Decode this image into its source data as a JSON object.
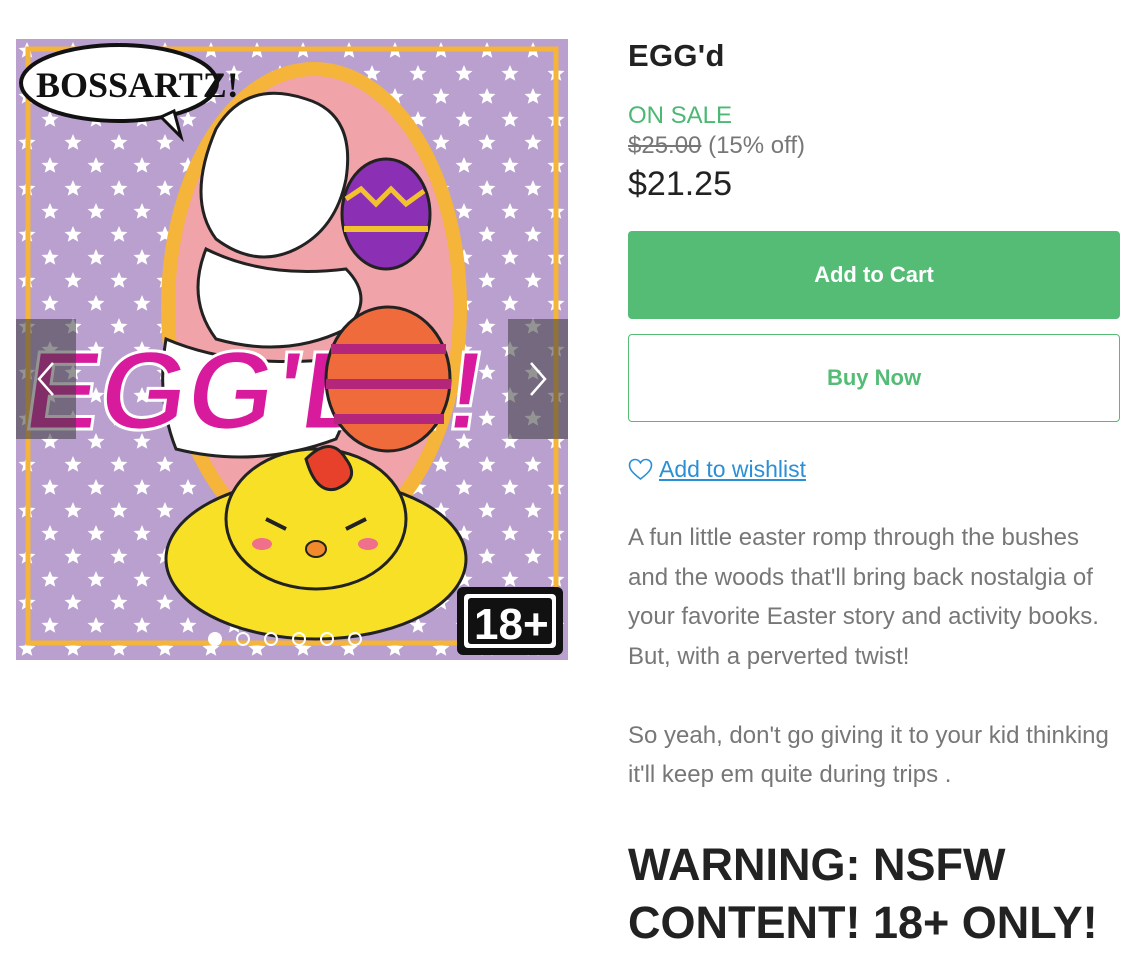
{
  "product": {
    "title": "EGG'd",
    "sale_label": "ON SALE",
    "original_price": "$25.00",
    "discount": "(15% off)",
    "price": "$21.25"
  },
  "actions": {
    "add_to_cart": "Add to Cart",
    "buy_now": "Buy Now",
    "wishlist": "Add to wishlist"
  },
  "description": {
    "paragraph_1": "A fun little easter romp through the bushes and the woods that'll bring back nostalgia of your favorite Easter story and activity books. But, with a perverted twist!",
    "paragraph_2": "So yeah, don't go giving it to your kid thinking it'll keep em quite during trips ."
  },
  "warning": "WARNING: NSFW CONTENT! 18+ ONLY!",
  "carousel": {
    "logo_text": "BOSSARTZ!",
    "cover_title": "EGG'D ON!",
    "rating_badge": "18+",
    "slide_count": 6,
    "active_slide": 1
  },
  "colors": {
    "accent_green": "#54bc75",
    "sale_green": "#4cb873",
    "link_blue": "#2b8fd6",
    "cover_purple": "#b9a0cf",
    "cover_magenta": "#d81b9c"
  }
}
